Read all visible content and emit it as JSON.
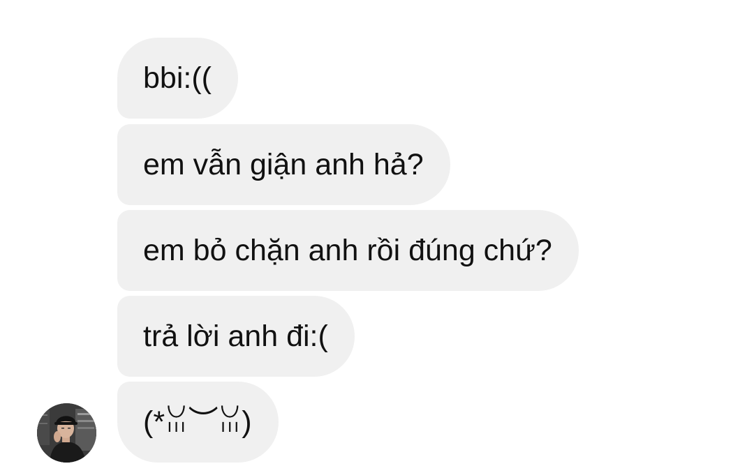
{
  "messages": [
    {
      "text": "bbi:(("
    },
    {
      "text": "em vẫn giận anh hả?"
    },
    {
      "text": "em bỏ chặn anh rồi đúng chứ?"
    },
    {
      "text": "trả lời anh đi:("
    },
    {
      "text": "(*ꈍ︶ꈍ)"
    }
  ],
  "colors": {
    "background": "#ffffff",
    "bubble": "#f0f0f0",
    "text": "#111111"
  },
  "sender": {
    "avatar_icon": "profile-photo-avatar"
  }
}
